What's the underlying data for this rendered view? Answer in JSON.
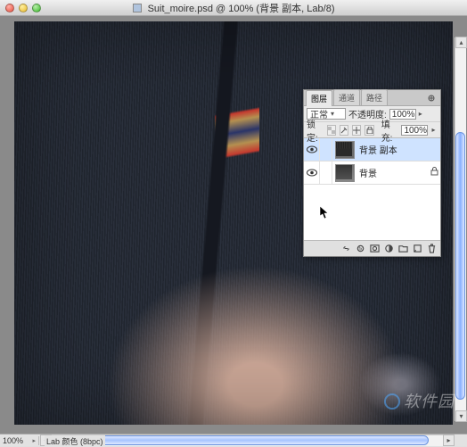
{
  "titlebar": {
    "filename": "Suit_moire.psd",
    "zoom": "100%",
    "layer_context": "背景 副本",
    "mode": "Lab/8"
  },
  "layers_panel": {
    "tabs": {
      "layers": "图层",
      "channels": "通道",
      "paths": "路径"
    },
    "blend_mode": {
      "label": "正常"
    },
    "opacity": {
      "label": "不透明度:",
      "value": "100%"
    },
    "lock_label": "锁定:",
    "fill": {
      "label": "填充:",
      "value": "100%"
    },
    "layers": [
      {
        "name": "背景 副本",
        "visible": true,
        "selected": true,
        "locked": false
      },
      {
        "name": "背景",
        "visible": true,
        "selected": false,
        "locked": true
      }
    ]
  },
  "status": {
    "zoom": "100%",
    "info": "Lab 颜色 (8bpc)"
  },
  "watermark": "软件园"
}
